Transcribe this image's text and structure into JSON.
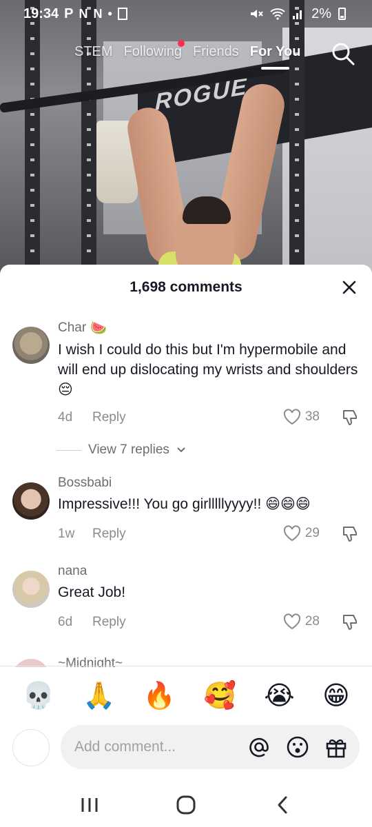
{
  "status_bar": {
    "time": "19:34",
    "app_icons": "P",
    "battery": "2%"
  },
  "top_nav": {
    "tabs": [
      {
        "label": "STEM",
        "active": false
      },
      {
        "label": "Following",
        "active": false,
        "dot": true
      },
      {
        "label": "Friends",
        "active": false
      },
      {
        "label": "For You",
        "active": true
      }
    ],
    "search_icon": "search-icon"
  },
  "video": {
    "banner_text": "ROGUE"
  },
  "comments_sheet": {
    "title": "1,698 comments",
    "close_icon": "close-icon",
    "comments": [
      {
        "username": "Char",
        "username_emoji": "🍉",
        "text": "I wish I could do this but I'm hypermobile and will end up dislocating my wrists and shoulders 😔",
        "time": "4d",
        "reply_label": "Reply",
        "likes": "38",
        "view_replies": "View 7 replies"
      },
      {
        "username": "Bossbabi",
        "text": "Impressive!!! You go girlllllyyyy!! 😄😄😄",
        "time": "1w",
        "reply_label": "Reply",
        "likes": "29"
      },
      {
        "username": "nana",
        "text": "Great Job!",
        "time": "6d",
        "reply_label": "Reply",
        "likes": "28"
      },
      {
        "username": "~Midnight~"
      }
    ],
    "quick_emojis": [
      "💀",
      "🙏",
      "🔥",
      "🥰",
      "😭",
      "😁"
    ],
    "compose": {
      "placeholder": "Add comment...",
      "icons": [
        "at-icon",
        "emoji-icon",
        "gift-icon"
      ]
    }
  },
  "system_nav": {
    "buttons": [
      "recents-button",
      "home-button",
      "back-button"
    ]
  }
}
